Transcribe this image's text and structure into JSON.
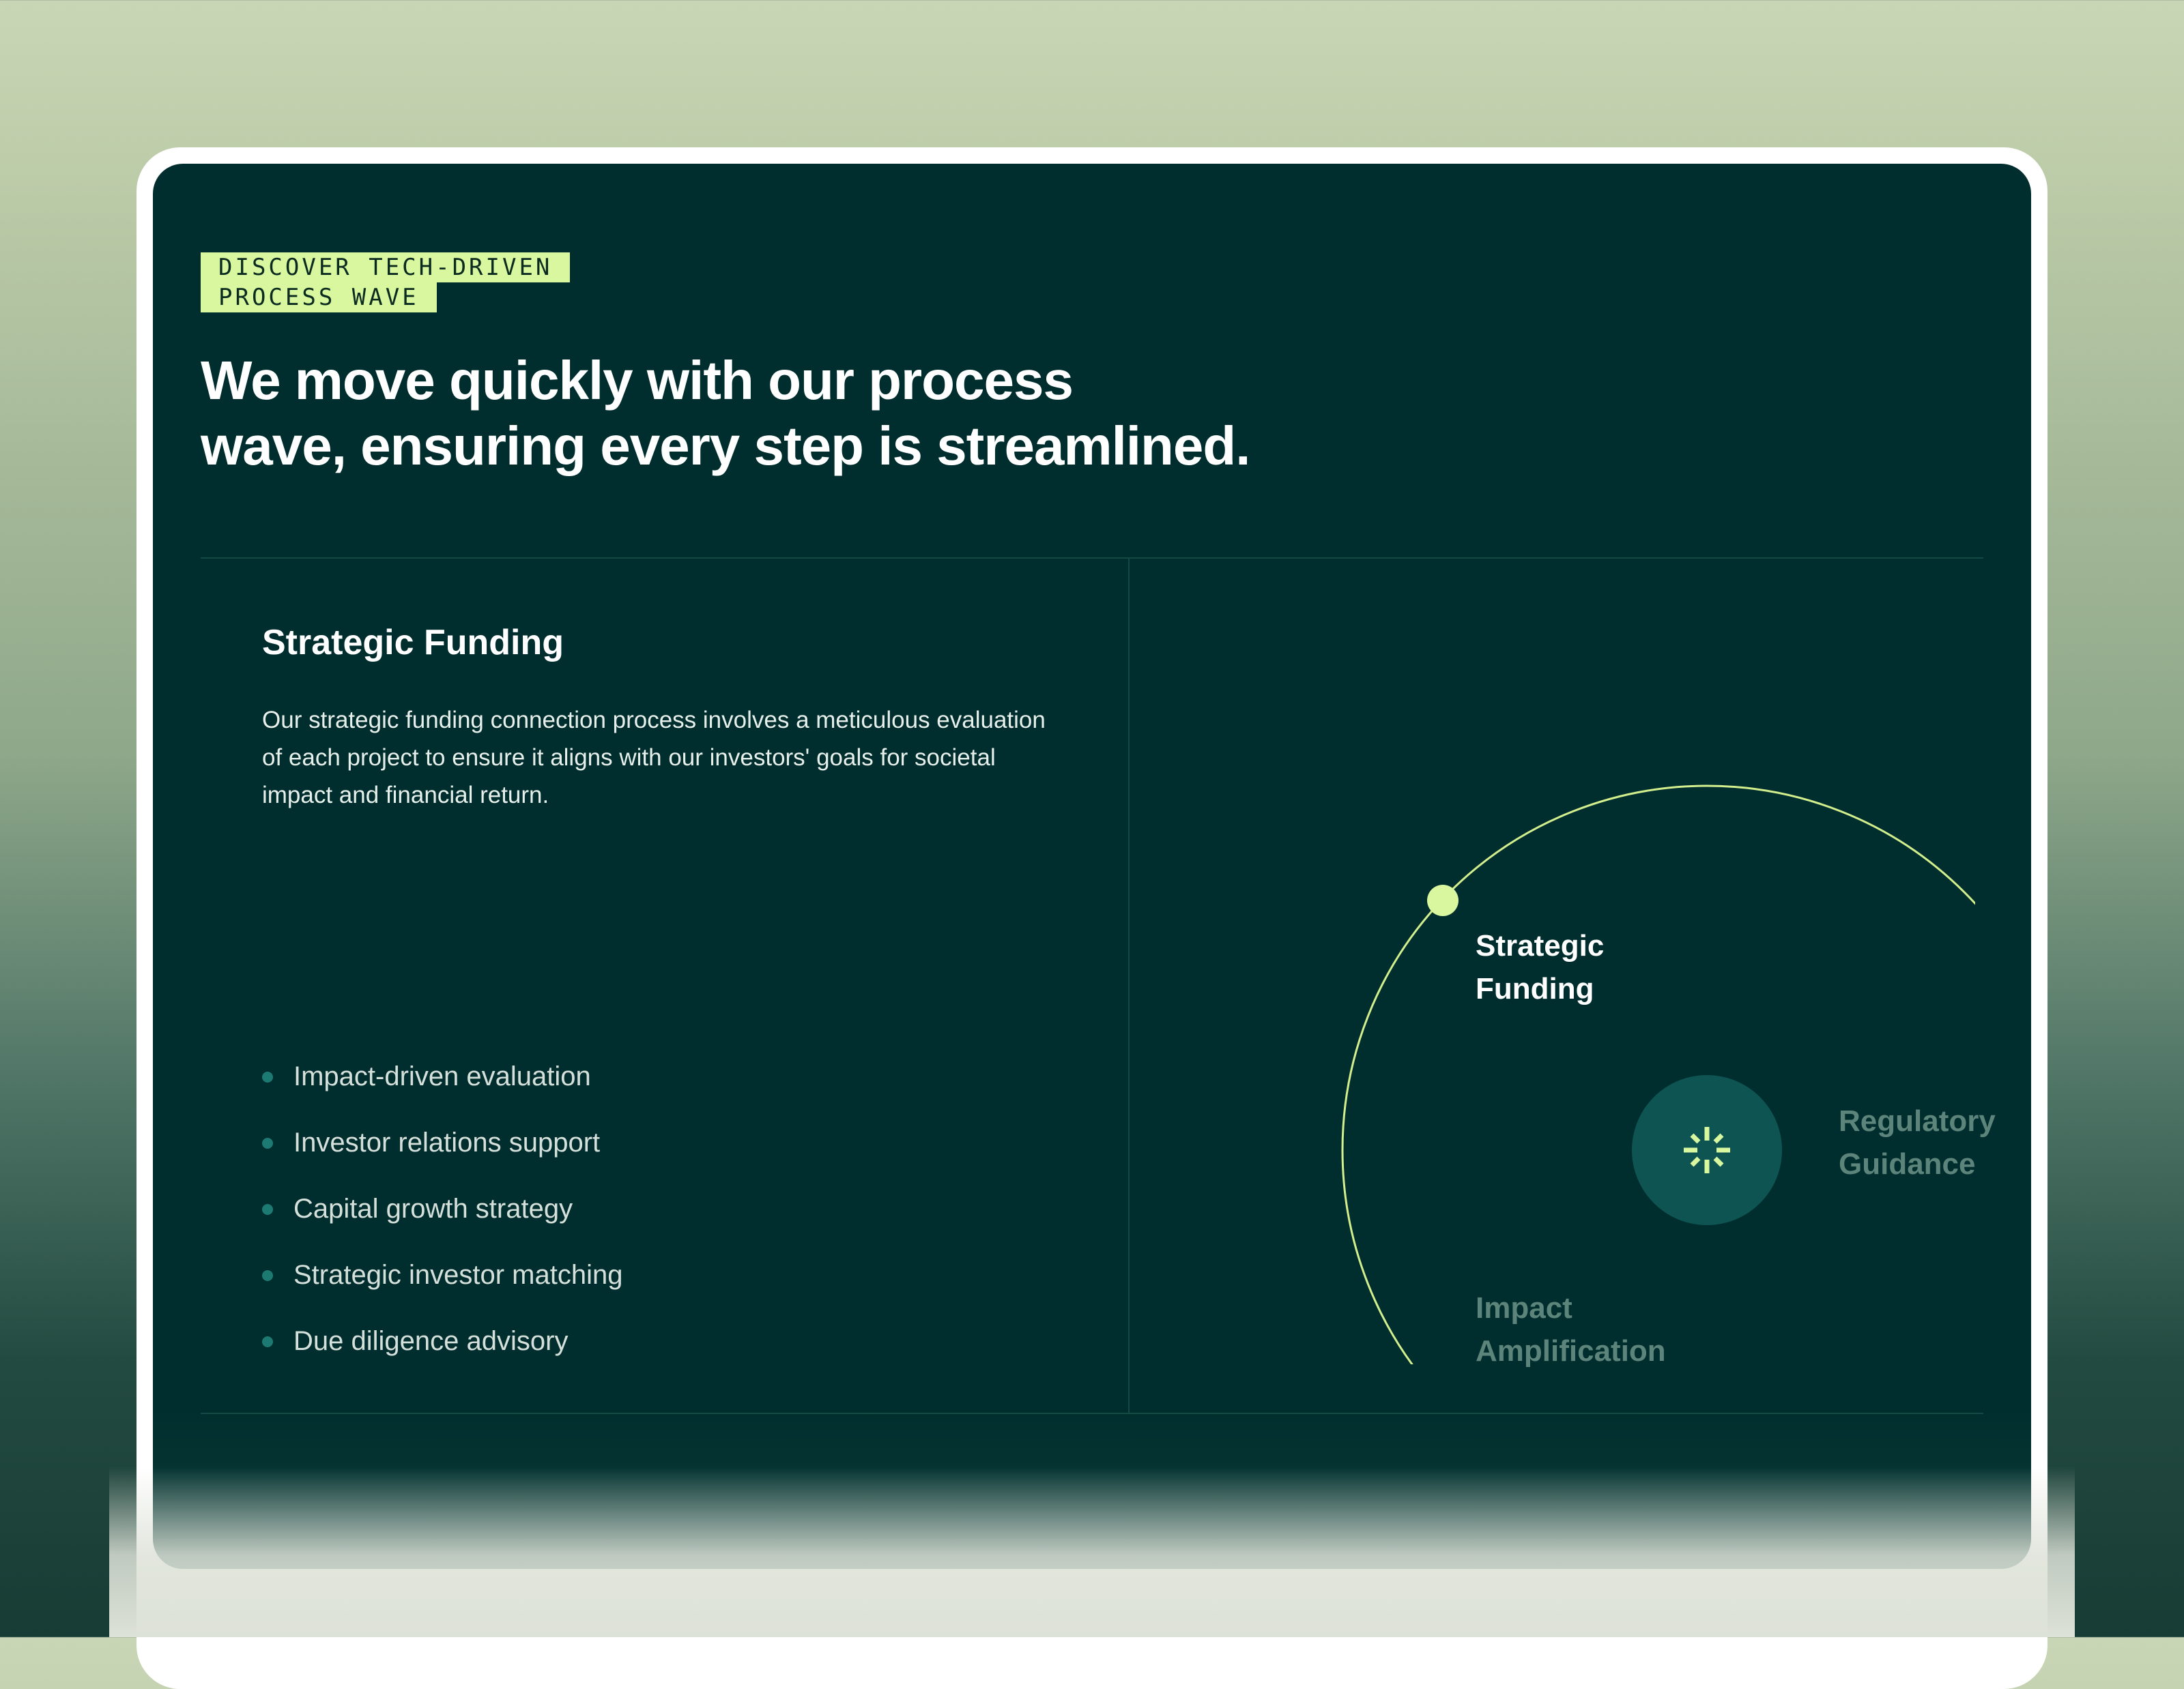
{
  "eyebrow": {
    "line1": "DISCOVER TECH-DRIVEN",
    "line2": "PROCESS WAVE"
  },
  "headline": {
    "line1": "We move quickly with our process",
    "line2": "wave, ensuring every step is streamlined."
  },
  "process": {
    "title": "Strategic Funding",
    "description": "Our strategic funding connection process involves a meticulous evaluation of each project to ensure it aligns with our investors' goals  for societal impact and financial return.",
    "features": [
      "Impact-driven evaluation",
      "Investor relations support",
      "Capital growth strategy",
      "Strategic investor matching",
      "Due diligence advisory"
    ]
  },
  "orbit": {
    "steps": [
      {
        "line1": "Strategic",
        "line2": "Funding",
        "active": true
      },
      {
        "line1": "Regulatory",
        "line2": "Guidance",
        "active": false
      },
      {
        "line1": "Impact",
        "line2": "Amplification",
        "active": false
      }
    ],
    "center_icon": "sparkle-icon"
  },
  "colors": {
    "card_background": "#002e2e",
    "accent_lime": "#d8f79e",
    "orbit_ring": "#d3ef8d",
    "inactive_node": "#3d6a57",
    "center_circle": "#0e5452",
    "bullet": "#1d7a72"
  }
}
